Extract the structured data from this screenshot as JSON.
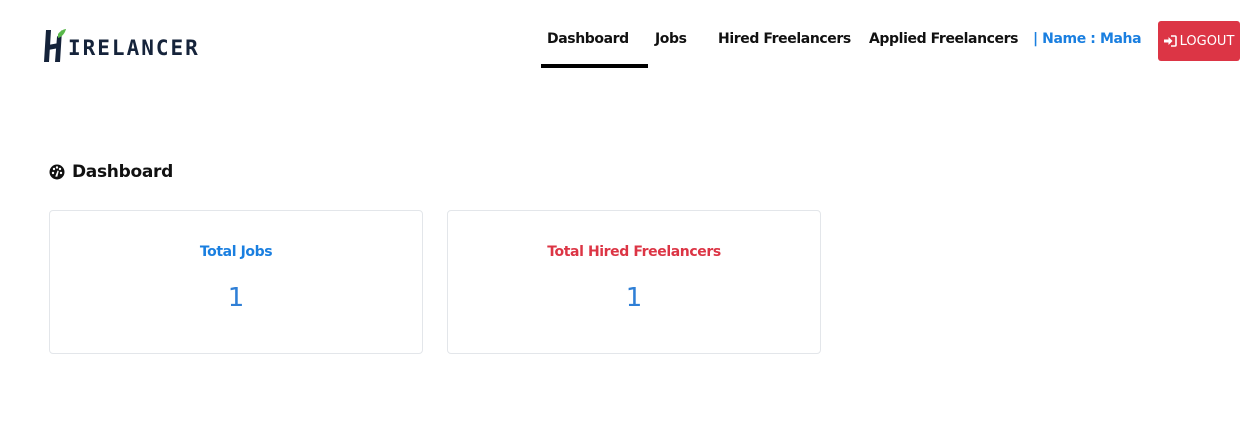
{
  "brand": {
    "logo_text": "IRELANCER"
  },
  "nav": {
    "items": [
      {
        "label": "Dashboard",
        "active": true
      },
      {
        "label": "Jobs",
        "active": false
      },
      {
        "label": "Hired Freelancers",
        "active": false
      },
      {
        "label": "Applied Freelancers",
        "active": false
      }
    ],
    "user_label": "| Name : Maha",
    "logout_label": "LOGOUT"
  },
  "section": {
    "title": "Dashboard",
    "icon": "dashboard-gauge-icon"
  },
  "cards": [
    {
      "title": "Total Jobs",
      "value": "1",
      "title_color": "#1a7fe0"
    },
    {
      "title": "Total Hired Freelancers",
      "value": "1",
      "title_color": "#dc3545"
    }
  ],
  "colors": {
    "accent": "#1a7fe0",
    "danger": "#dc3545",
    "value": "#2f7fd6",
    "logo_green": "#59b84a",
    "logo_dark": "#15233a"
  }
}
